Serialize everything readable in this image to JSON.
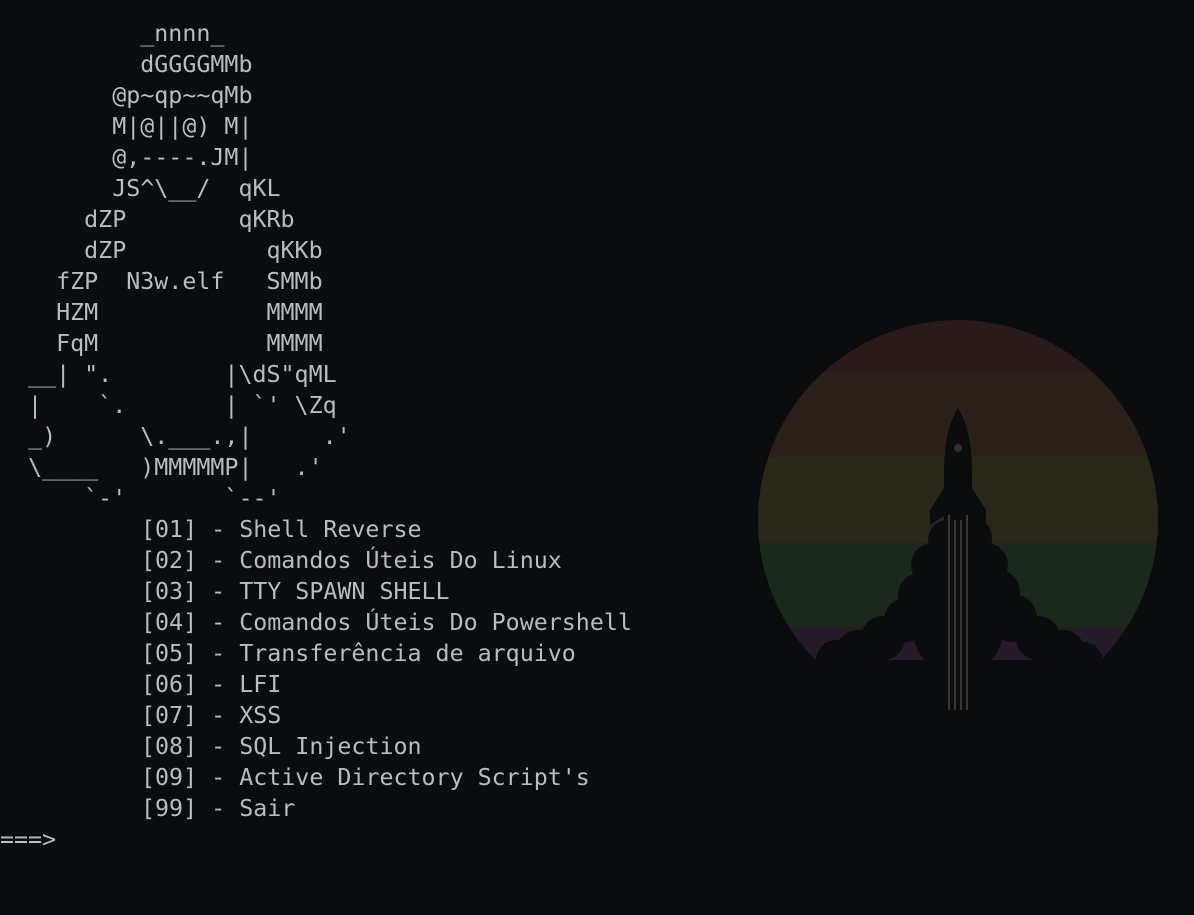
{
  "ascii_art": [
    "          _nnnn_",
    "          dGGGGMMb",
    "        @p~qp~~qMb",
    "        M|@||@) M|",
    "        @,----.JM|",
    "        JS^\\__/  qKL",
    "      dZP        qKRb",
    "      dZP          qKKb",
    "    fZP  N3w.elf   SMMb",
    "    HZM            MMMM",
    "    FqM            MMMM",
    "  __| \".        |\\dS\"qML",
    "  |    `.       | `' \\Zq",
    "  _)      \\.___.,|     .'",
    "  \\____   )MMMMMP|   .'",
    "      `-'       `--'"
  ],
  "menu": [
    {
      "num": "[01]",
      "sep": " - ",
      "label": "Shell Reverse"
    },
    {
      "num": "[02]",
      "sep": " - ",
      "label": "Comandos Úteis Do Linux"
    },
    {
      "num": "[03]",
      "sep": " - ",
      "label": "TTY SPAWN SHELL"
    },
    {
      "num": "[04]",
      "sep": " - ",
      "label": "Comandos Úteis Do Powershell"
    },
    {
      "num": "[05]",
      "sep": " - ",
      "label": "Transferência de arquivo"
    },
    {
      "num": "[06]",
      "sep": " - ",
      "label": "LFI"
    },
    {
      "num": "[07]",
      "sep": " - ",
      "label": "XSS"
    },
    {
      "num": "[08]",
      "sep": " - ",
      "label": "SQL Injection"
    },
    {
      "num": "[09]",
      "sep": " - ",
      "label": "Active Directory Script's"
    },
    {
      "num": "[99]",
      "sep": " - ",
      "label": "Sair"
    }
  ],
  "prompt": "===>",
  "wallpaper": {
    "icon": "rocket-icon",
    "bands": [
      "#2a1a1a",
      "#2b1f1a",
      "#2a2818",
      "#1c2a1c",
      "#1a1f2a",
      "#241a28"
    ],
    "rocket_color": "#0b0c0e"
  }
}
